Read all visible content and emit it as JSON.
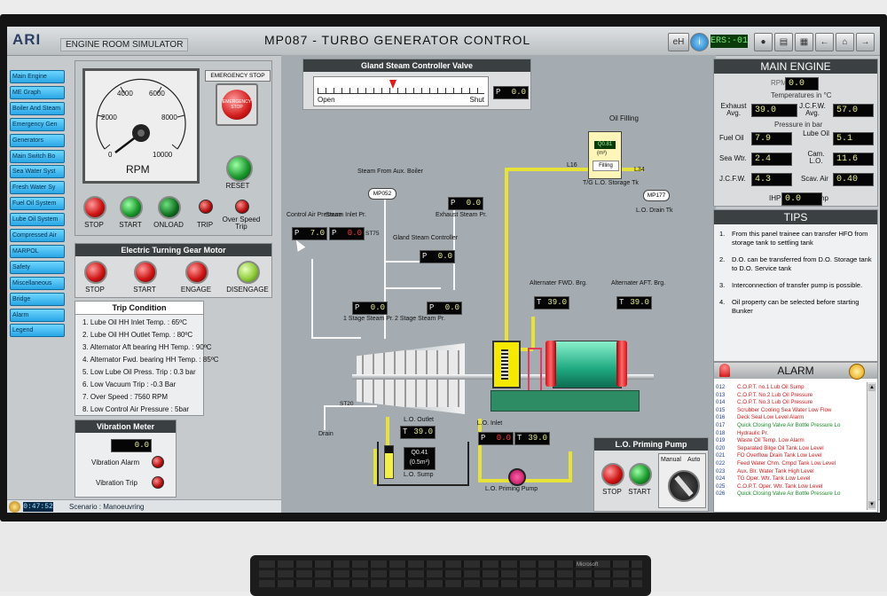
{
  "header": {
    "logo": "ARI",
    "simulator_label": "ENGINE ROOM SIMULATOR",
    "title": "MP087 - TURBO GENERATOR CONTROL",
    "help_label": "eH",
    "ers_label": "ERS:-01"
  },
  "sidebar": {
    "items": [
      "Main Engine",
      "ME Graph",
      "Boiler And Steam",
      "Emergency Gen",
      "Generators",
      "Main Switch Bo",
      "Sea Water Syst",
      "Fresh Water Sy",
      "Fuel Oil System",
      "Lube Oil System",
      "Compressed Air",
      "MARPOL",
      "Safety",
      "Miscellaneous",
      "Bridge",
      "Alarm",
      "Legend"
    ]
  },
  "status_bar": {
    "clock": "0:47:52",
    "scenario": "Scenario : Manoeuvring"
  },
  "rpm_panel": {
    "gauge_label": "RPM",
    "gauge_ticks": [
      "0",
      "2000",
      "4000",
      "6000",
      "8000",
      "10000"
    ],
    "emergency_stop_label": "EMERGENCY STOP",
    "emergency_button_text": "EMERGENCY STOP",
    "reset_label": "RESET",
    "stop_label": "STOP",
    "start_label": "START",
    "onload_label": "ONLOAD",
    "trip_label": "TRIP",
    "overspeed_label": "Over Speed Trip"
  },
  "turning_gear": {
    "title": "Electric Turning Gear Motor",
    "buttons": [
      "STOP",
      "START",
      "ENGAGE",
      "DISENGAGE"
    ]
  },
  "trip_condition": {
    "title": "Trip Condition",
    "items": [
      "1. Lube Oil HH Inlet Temp. : 65ºC",
      "2. Lube Oil HH Outlet Temp. : 80ºC",
      "3. Alternator Aft bearing HH Temp. : 90ºC",
      "4. Alternator Fwd. bearing HH Temp. : 85ºC",
      "5. Low Lube Oil Press. Trip : 0.3 bar",
      "6. Low Vacuum Trip : -0.3 Bar",
      "7. Over Speed : 7560 RPM",
      "8. Low Control Air Pressure : 5bar"
    ]
  },
  "vibration": {
    "title": "Vibration Meter",
    "value": "0.0",
    "alarm_label": "Vibration Alarm",
    "trip_label": "Vibration Trip"
  },
  "gland_valve": {
    "title": "Gland Steam Controller Valve",
    "open_label": "Open",
    "shut_label": "Shut",
    "p_value": "0.0",
    "valve_position": 0.45
  },
  "mimic": {
    "oil_filling_label": "Oil Filling",
    "storage_tank_label": "T/G L.O. Storage Tk",
    "storage_quantity": "Q0.81",
    "storage_unit": "(m³)",
    "filling_label": "Filling",
    "l16_label": "L16",
    "l34_label": "L34",
    "mp177_label": "MP177",
    "drain_tk_label": "L.O. Drain Tk",
    "steam_from_boiler_label": "Steam From Aux. Boiler",
    "mp052_label": "MP052",
    "control_air_label": "Control Air Pressure",
    "control_air_value": "7.0",
    "steam_inlet_label": "Steam Inlet Pr.",
    "steam_inlet_value": "0.0",
    "st75_label": "ST75",
    "exhaust_steam_label": "Exhaust Steam Pr.",
    "exhaust_steam_value": "0.0",
    "gland_ctrl_label": "Gland Steam Controller",
    "gland_ctrl_value": "0.0",
    "stage1_label": "1 Stage Steam Pr.",
    "stage1_value": "0.0",
    "stage2_label": "2 Stage Steam Pr.",
    "stage2_value": "0.0",
    "alt_fwd_label": "Alternater FWD. Brg.",
    "alt_fwd_value": "39.0",
    "alt_aft_label": "Alternater AFT. Brg.",
    "alt_aft_value": "39.0",
    "st20_label": "ST20",
    "drain_label": "Drain",
    "lo_outlet_label": "L.O. Outlet",
    "lo_outlet_value": "39.0",
    "lo_inlet_label": "L.O. Inlet",
    "lo_inlet_p_value": "0.0",
    "lo_inlet_t_value": "39.0",
    "sump_quantity": "Q0.41",
    "sump_unit": "(0.5m³)",
    "sump_label": "L.O. Sump",
    "priming_pump_label": "L.O. Priming Pump",
    "p_prefix": "P",
    "t_prefix": "T"
  },
  "priming_panel": {
    "title": "L.O. Priming Pump",
    "stop_label": "STOP",
    "start_label": "START",
    "manual_label": "Manual",
    "auto_label": "Auto"
  },
  "main_engine": {
    "title": "MAIN ENGINE",
    "rpm_label": "RPM",
    "rpm_value": "0.0",
    "temp_header": "Temperatures in °C",
    "exhaust_label": "Exhaust Avg.",
    "exhaust_value": "39.0",
    "jcfw_temp_label": "J.C.F.W. Avg.",
    "jcfw_temp_value": "57.0",
    "pressure_header": "Pressure in bar",
    "fuel_oil_label": "Fuel Oil",
    "fuel_oil_value": "7.9",
    "lube_oil_label": "Lube Oil",
    "lube_oil_value": "5.1",
    "sea_wtr_label": "Sea Wtr.",
    "sea_wtr_value": "2.4",
    "cam_lo_label": "Cam. L.O.",
    "cam_lo_value": "11.6",
    "jcfw_p_label": "J.C.F.W.",
    "jcfw_p_value": "4.3",
    "scav_air_label": "Scav. Air",
    "scav_air_value": "0.40",
    "ihp_label": "IHP",
    "ihp_value": "0.0",
    "hp_label": "hp"
  },
  "tips": {
    "title": "TIPS",
    "items": [
      "From this panel trainee can transfer HFO from storage tank to settling tank",
      "D.O. can be transferred from D.O. Storage tank to D.O. Service tank",
      "Interconnection of transfer pump is possible.",
      "Oil property can be selected before starting Bunker"
    ]
  },
  "alarm": {
    "title": "ALARM",
    "rows": [
      {
        "num": "012",
        "text": "C.O.P.T. no.1 Lub Oil Sump",
        "green": false
      },
      {
        "num": "013",
        "text": "C.O.P.T. No.2 Lub Oil Pressure",
        "green": false
      },
      {
        "num": "014",
        "text": "C.O.P.T. No.3 Lub Oil Pressure",
        "green": false
      },
      {
        "num": "015",
        "text": "Scrubber Cooling Sea Water Low Flow",
        "green": false
      },
      {
        "num": "016",
        "text": "Deck Seal Low Level Alarm",
        "green": false
      },
      {
        "num": "017",
        "text": "Quick Closing Valve Air Bottle Pressure Lo",
        "green": true
      },
      {
        "num": "018",
        "text": "Hydraulic Pr.",
        "green": false
      },
      {
        "num": "019",
        "text": "Waste Oil Temp. Low Alarm",
        "green": false
      },
      {
        "num": "020",
        "text": "Separated Bilge Oil Tank Low Level",
        "green": false
      },
      {
        "num": "021",
        "text": "FO Overflow Drain Tank Low Level",
        "green": false
      },
      {
        "num": "022",
        "text": "Feed Water Chm. Cmpd Tank Low Level",
        "green": false
      },
      {
        "num": "023",
        "text": "Aux. Blr. Water Tank High Level",
        "green": false
      },
      {
        "num": "024",
        "text": "TG Oper. Wtr. Tank Low Level",
        "green": false
      },
      {
        "num": "025",
        "text": "C.O.P.T. Oper. Wtr. Tank Low Level",
        "green": false
      },
      {
        "num": "026",
        "text": "Quick Closing Valve Air Bottle Pressure Lo",
        "green": true
      }
    ]
  },
  "keyboard": {
    "brand": "Microsoft"
  }
}
